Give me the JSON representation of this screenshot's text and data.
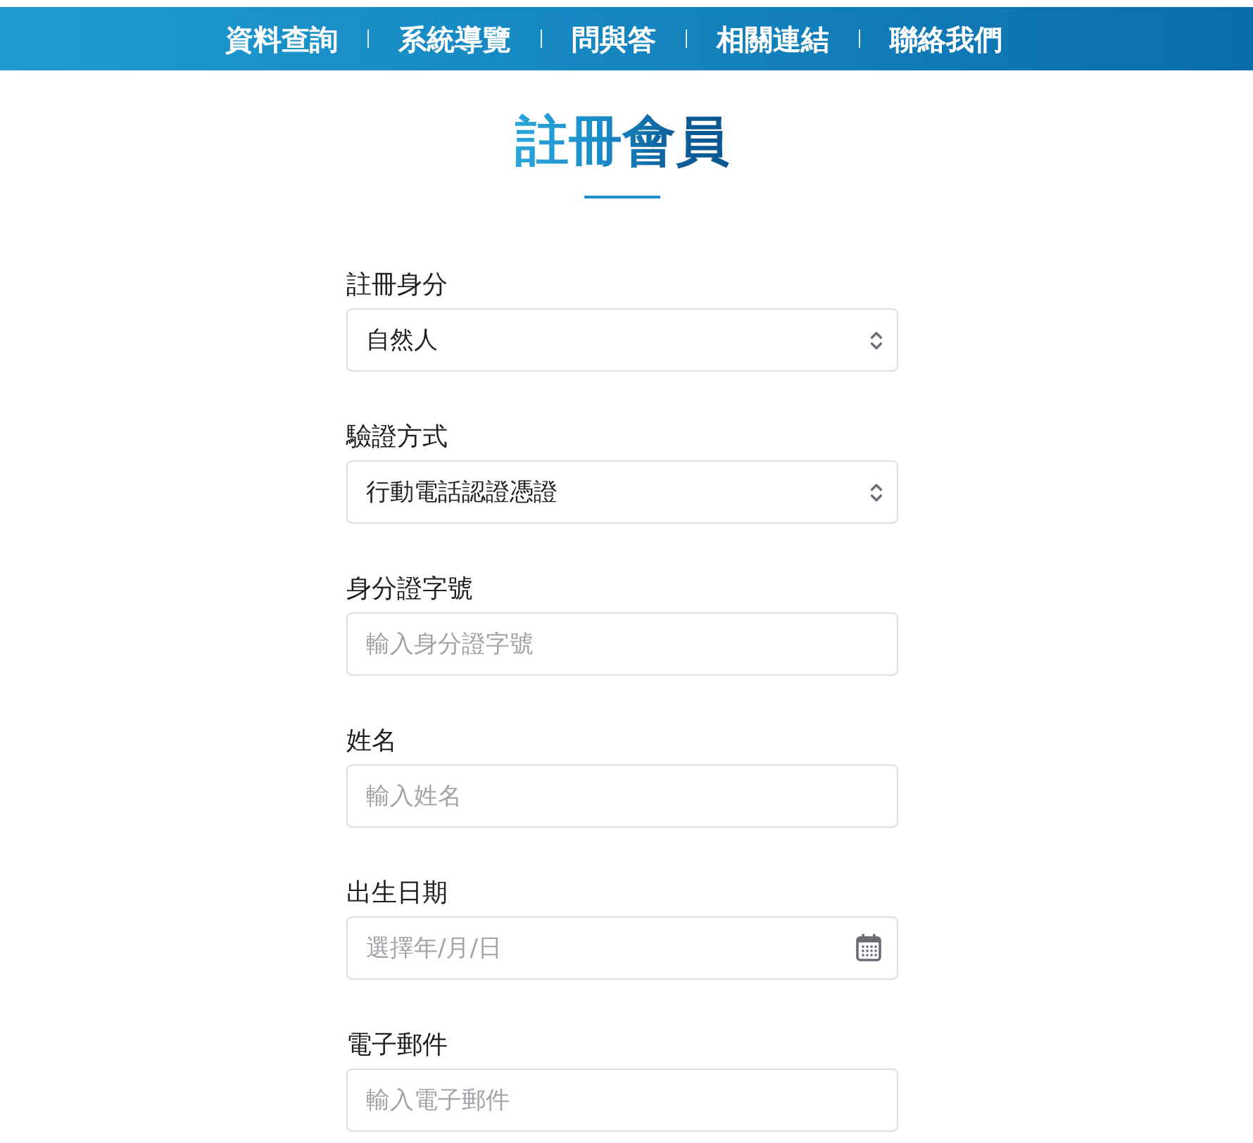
{
  "nav": {
    "items": [
      {
        "label": "資料查詢"
      },
      {
        "label": "系統導覽"
      },
      {
        "label": "問與答"
      },
      {
        "label": "相關連結"
      },
      {
        "label": "聯絡我們"
      }
    ]
  },
  "page_title": "註冊會員",
  "form": {
    "fields": [
      {
        "kind": "select",
        "label": "註冊身分",
        "value": "自然人"
      },
      {
        "kind": "select",
        "label": "驗證方式",
        "value": "行動電話認證憑證"
      },
      {
        "kind": "text",
        "label": "身分證字號",
        "placeholder": "輸入身分證字號"
      },
      {
        "kind": "text",
        "label": "姓名",
        "placeholder": "輸入姓名"
      },
      {
        "kind": "date",
        "label": "出生日期",
        "placeholder": "選擇年/月/日"
      },
      {
        "kind": "email",
        "label": "電子郵件",
        "placeholder": "輸入電子郵件"
      }
    ]
  }
}
